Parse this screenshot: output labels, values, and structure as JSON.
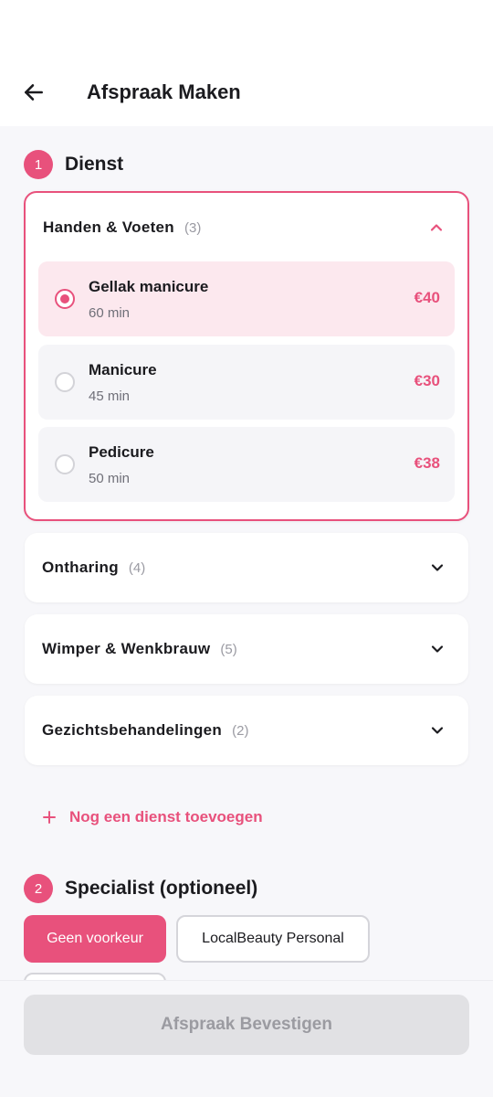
{
  "header": {
    "title": "Afspraak Maken",
    "back_icon": "arrow-left-icon"
  },
  "step1": {
    "number": "1",
    "title": "Dienst"
  },
  "categories": [
    {
      "name": "Handen & Voeten",
      "count": "(3)",
      "expanded": true,
      "services": [
        {
          "name": "Gellak manicure",
          "duration": "60 min",
          "price": "€40",
          "selected": true
        },
        {
          "name": "Manicure",
          "duration": "45 min",
          "price": "€30",
          "selected": false
        },
        {
          "name": "Pedicure",
          "duration": "50 min",
          "price": "€38",
          "selected": false
        }
      ]
    },
    {
      "name": "Ontharing",
      "count": "(4)",
      "expanded": false
    },
    {
      "name": "Wimper & Wenkbrauw",
      "count": "(5)",
      "expanded": false
    },
    {
      "name": "Gezichtsbehandelingen",
      "count": "(2)",
      "expanded": false
    }
  ],
  "add_service": {
    "label": "Nog een dienst toevoegen",
    "icon": "plus-icon"
  },
  "step2": {
    "number": "2",
    "title": "Specialist (optioneel)"
  },
  "specialists": [
    {
      "label": "Geen voorkeur",
      "active": true
    },
    {
      "label": "LocalBeauty Personal",
      "active": false
    }
  ],
  "confirm": {
    "label": "Afspraak Bevestigen",
    "disabled": true
  },
  "colors": {
    "accent": "#e8517c",
    "accent_light": "#fce8ee",
    "background": "#f7f7fa",
    "disabled": "#e1e1e4"
  }
}
